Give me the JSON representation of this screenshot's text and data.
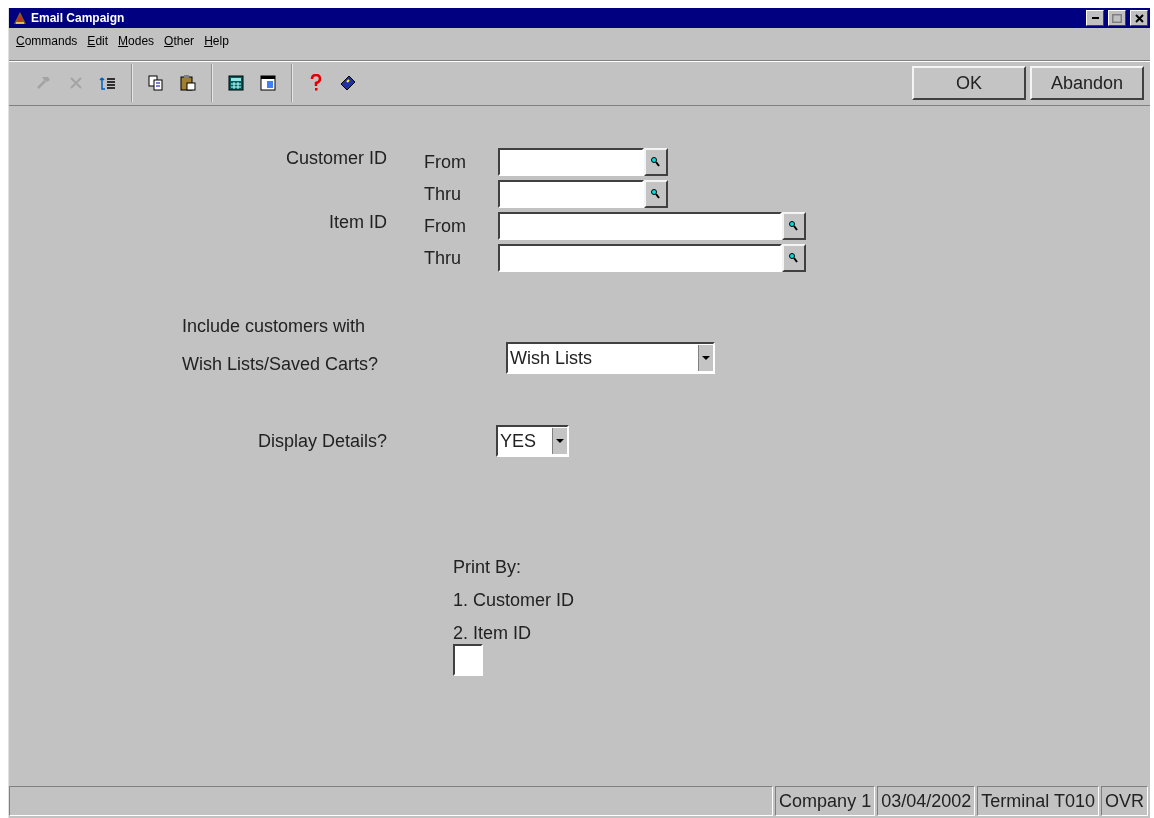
{
  "window": {
    "title": "Email Campaign"
  },
  "menu": [
    "Commands",
    "Edit",
    "Modes",
    "Other",
    "Help"
  ],
  "toolbar": {
    "groups": [
      [
        {
          "kind": "hammer",
          "disabled": true
        },
        {
          "kind": "cross",
          "disabled": true
        },
        {
          "kind": "list",
          "disabled": false
        }
      ],
      [
        {
          "kind": "copy",
          "disabled": false
        },
        {
          "kind": "paste",
          "disabled": false
        }
      ],
      [
        {
          "kind": "calculator",
          "disabled": false
        },
        {
          "kind": "calendar",
          "disabled": false
        }
      ],
      [
        {
          "kind": "question",
          "disabled": false
        },
        {
          "kind": "book",
          "disabled": false
        }
      ]
    ],
    "buttons": [
      "OK",
      "Abandon"
    ]
  },
  "ranges": [
    {
      "label": "Customer ID",
      "wide": false,
      "rows": [
        {
          "label": "From"
        },
        {
          "label": "Thru"
        }
      ]
    },
    {
      "label": "Item ID",
      "wide": true,
      "rows": [
        {
          "label": "From"
        },
        {
          "label": "Thru"
        }
      ]
    }
  ],
  "wish_lists": {
    "label_lines": [
      "Include customers with",
      "Wish Lists/Saved Carts?"
    ],
    "value": "Wish Lists"
  },
  "display_details": {
    "label": "Display Details?",
    "value": "YES"
  },
  "print_by": {
    "lines": [
      "Print By:",
      "1. Customer ID",
      "2. Item ID"
    ]
  },
  "status_bar": [
    "Company 1",
    "03/04/2002",
    "Terminal T010",
    "OVR"
  ]
}
